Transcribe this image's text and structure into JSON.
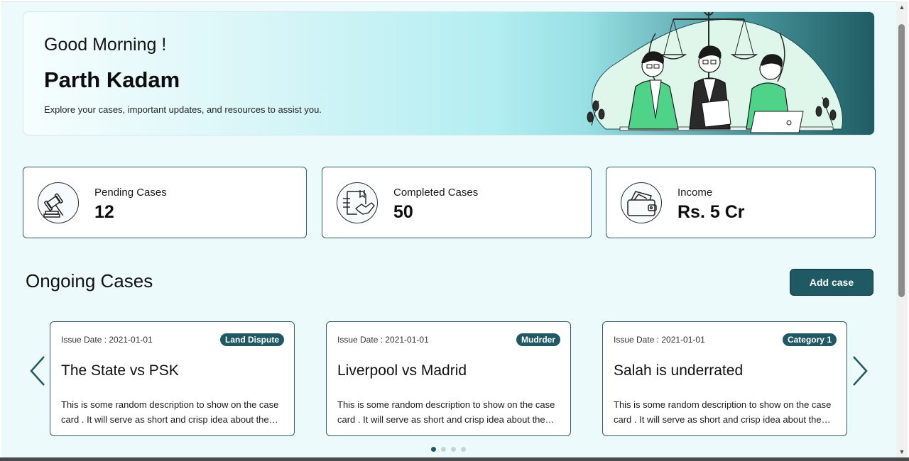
{
  "banner": {
    "greeting": "Good Morning !",
    "user_name": "Parth Kadam",
    "subtitle": "Explore your cases, important updates, and resources to assist you."
  },
  "stats": [
    {
      "label": "Pending Cases",
      "value": "12",
      "icon": "gavel-icon"
    },
    {
      "label": "Completed Cases",
      "value": "50",
      "icon": "handshake-document-icon"
    },
    {
      "label": "Income",
      "value": "Rs. 5 Cr",
      "icon": "wallet-icon"
    }
  ],
  "ongoing": {
    "title": "Ongoing Cases",
    "add_button": "Add case",
    "cards": [
      {
        "date": "Issue Date : 2021-01-01",
        "tag": "Land Dispute",
        "title": "The State vs PSK",
        "description": "This is some random description to show on the case card . It will serve as short and crisp idea about the case"
      },
      {
        "date": "Issue Date : 2021-01-01",
        "tag": "Mudrder",
        "title": "Liverpool vs Madrid",
        "description": "This is some random description to show on the case card . It will serve as short and crisp idea about the case"
      },
      {
        "date": "Issue Date : 2021-01-01",
        "tag": "Category 1",
        "title": "Salah is underrated",
        "description": "This is some random description to show on the case card . It will serve as short and crisp idea about the case"
      }
    ],
    "pagination": {
      "total": 4,
      "current": 1
    }
  },
  "colors": {
    "accent": "#1f5963",
    "background": "#ecfafb",
    "card_border": "#2b5f66"
  }
}
